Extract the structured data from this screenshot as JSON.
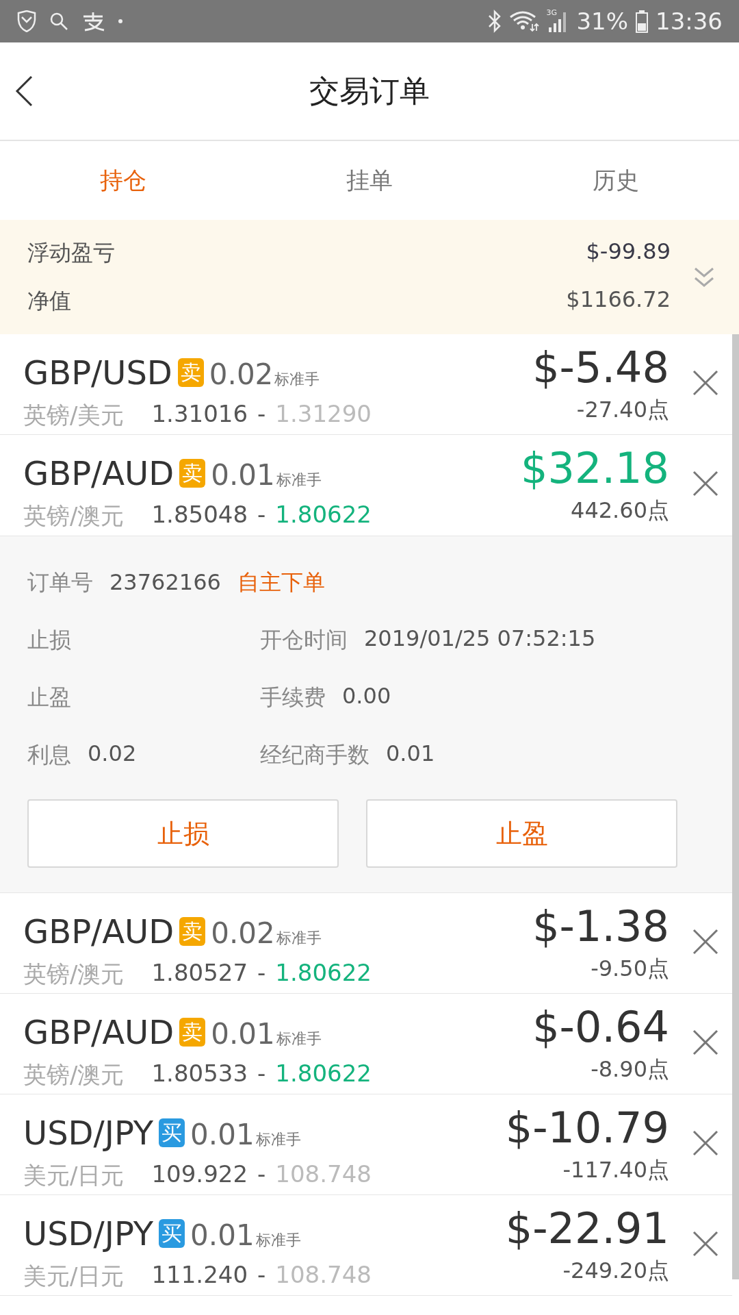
{
  "status_bar": {
    "network": "3G",
    "battery": "31%",
    "time": "13:36"
  },
  "header": {
    "title": "交易订单"
  },
  "tabs": [
    {
      "label": "持仓",
      "selected": true
    },
    {
      "label": "挂单",
      "selected": false
    },
    {
      "label": "历史",
      "selected": false
    }
  ],
  "summary": {
    "rows": [
      {
        "label": "浮动盈亏",
        "value": "$-99.89"
      },
      {
        "label": "净值",
        "value": "$1166.72"
      }
    ]
  },
  "orders": [
    {
      "symbol": "GBP/USD",
      "kind": "sell",
      "side": "卖",
      "lots": "0.02",
      "unit": "标准手",
      "name": "英镑/美元",
      "open": "1.31016",
      "sep": "-",
      "quote": {
        "text": "1.31290",
        "color": "#bbbbbb"
      },
      "profit": {
        "text": "$-5.48",
        "color": "#333333"
      },
      "points": "-27.40点",
      "expanded": false
    },
    {
      "symbol": "GBP/AUD",
      "kind": "sell",
      "side": "卖",
      "lots": "0.01",
      "unit": "标准手",
      "name": "英镑/澳元",
      "open": "1.85048",
      "sep": "-",
      "quote": {
        "text": "1.80622",
        "color": "#14b37d"
      },
      "profit": {
        "text": "$32.18",
        "color": "#14b37d"
      },
      "points": "442.60点",
      "expanded": true,
      "details": {
        "order_label": "订单号",
        "order_no": "23762166",
        "order_type": "自主下单",
        "fields": [
          {
            "label": "止损"
          },
          {
            "label": "开仓时间",
            "value": "2019/01/25 07:52:15"
          },
          {
            "label": "止盈"
          },
          {
            "label": "手续费",
            "value": "0.00"
          },
          {
            "label": "利息",
            "value": "0.02"
          },
          {
            "label": "经纪商手数",
            "value": "0.01"
          }
        ],
        "buttons": [
          "止损",
          "止盈"
        ]
      }
    },
    {
      "symbol": "GBP/AUD",
      "kind": "sell",
      "side": "卖",
      "lots": "0.02",
      "unit": "标准手",
      "name": "英镑/澳元",
      "open": "1.80527",
      "sep": "-",
      "quote": {
        "text": "1.80622",
        "color": "#14b37d"
      },
      "profit": {
        "text": "$-1.38",
        "color": "#333333"
      },
      "points": "-9.50点",
      "expanded": false
    },
    {
      "symbol": "GBP/AUD",
      "kind": "sell",
      "side": "卖",
      "lots": "0.01",
      "unit": "标准手",
      "name": "英镑/澳元",
      "open": "1.80533",
      "sep": "-",
      "quote": {
        "text": "1.80622",
        "color": "#14b37d"
      },
      "profit": {
        "text": "$-0.64",
        "color": "#333333"
      },
      "points": "-8.90点",
      "expanded": false
    },
    {
      "symbol": "USD/JPY",
      "kind": "buy",
      "side": "买",
      "lots": "0.01",
      "unit": "标准手",
      "name": "美元/日元",
      "open": "109.922",
      "sep": "-",
      "quote": {
        "text": "108.748",
        "color": "#bbbbbb"
      },
      "profit": {
        "text": "$-10.79",
        "color": "#333333"
      },
      "points": "-117.40点",
      "expanded": false
    },
    {
      "symbol": "USD/JPY",
      "kind": "buy",
      "side": "买",
      "lots": "0.01",
      "unit": "标准手",
      "name": "美元/日元",
      "open": "111.240",
      "sep": "-",
      "quote": {
        "text": "108.748",
        "color": "#bbbbbb"
      },
      "profit": {
        "text": "$-22.91",
        "color": "#333333"
      },
      "points": "-249.20点",
      "expanded": false
    }
  ]
}
